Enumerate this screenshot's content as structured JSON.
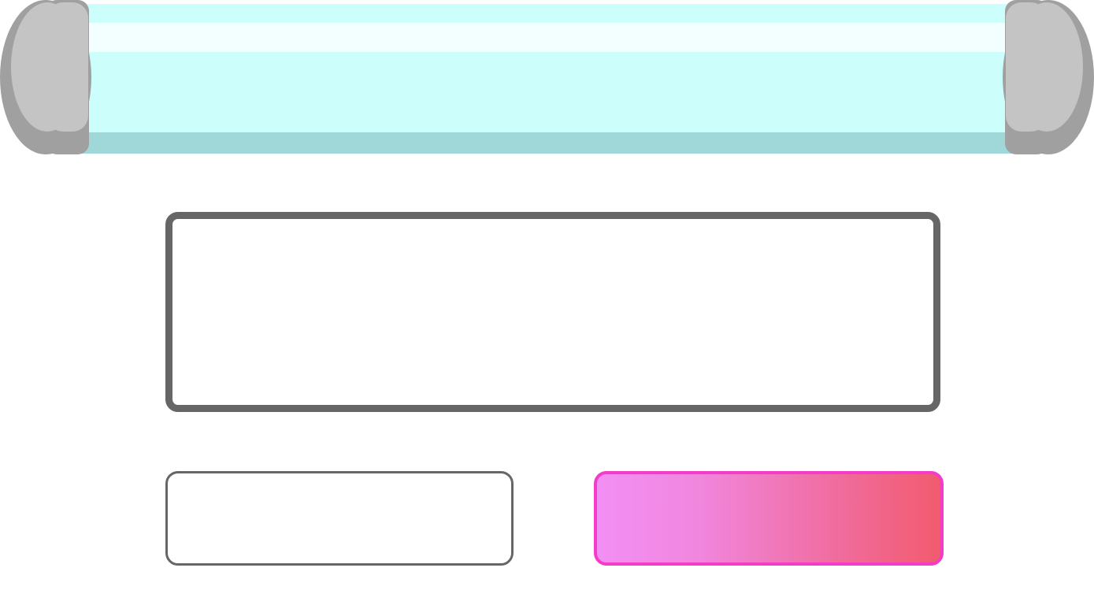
{
  "banner": {
    "type": "scroll-tube",
    "colors": {
      "tube": "#ccfefc",
      "tube_highlight": "#f3feff",
      "tube_shadow": "#a0d8da",
      "cap_outer": "#a0a0a0",
      "cap_inner": "#c4c4c4"
    }
  },
  "display": {
    "text": "",
    "border_color": "#666666"
  },
  "buttons": {
    "left": {
      "label": "",
      "border_color": "#666666"
    },
    "right": {
      "label": "",
      "border_color": "#f53cc8",
      "gradient": [
        "#f28ff5",
        "#f25b6e"
      ]
    }
  }
}
